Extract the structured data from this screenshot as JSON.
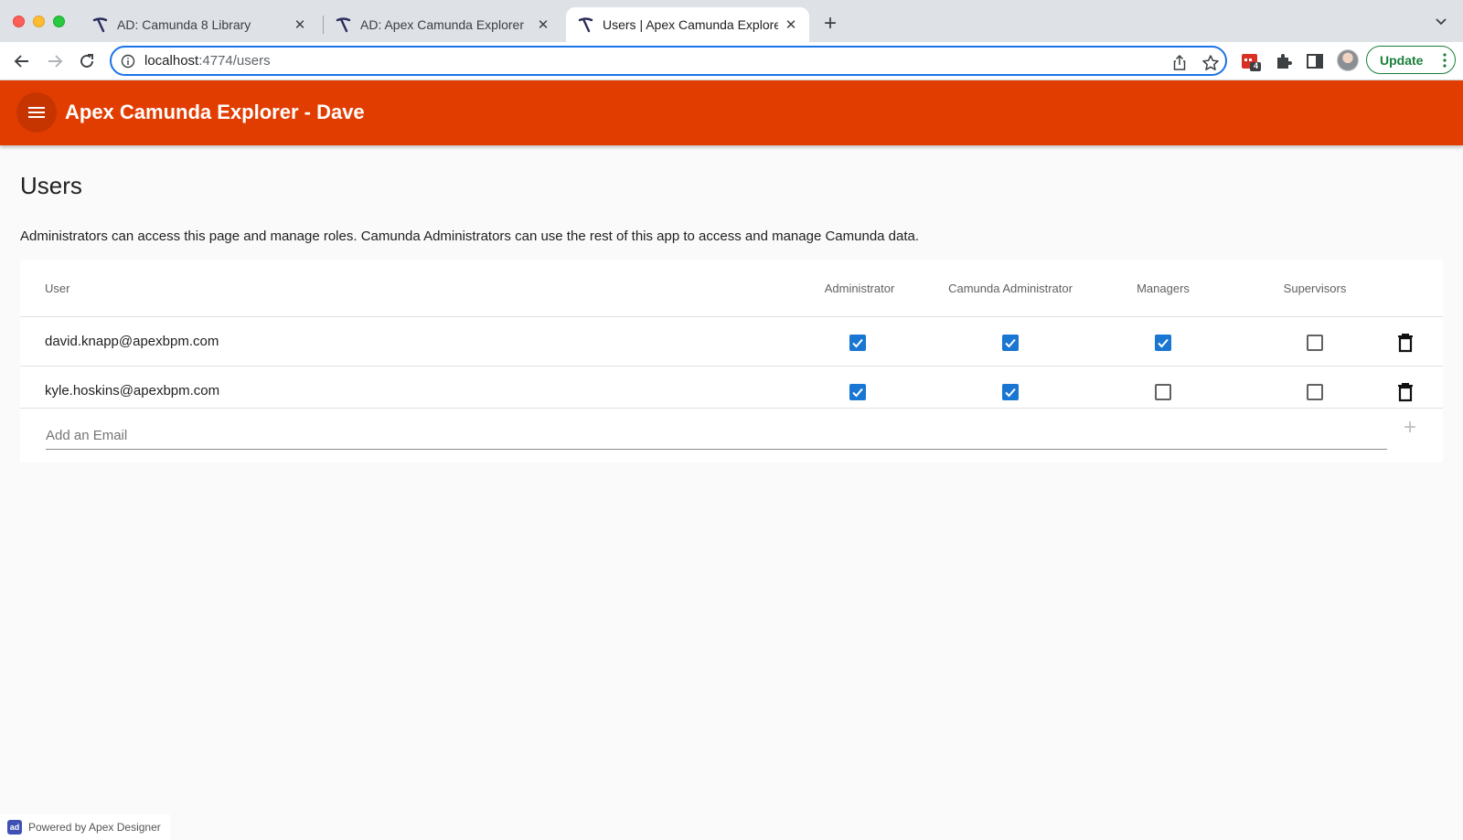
{
  "browser": {
    "tabs": [
      {
        "title": "AD: Camunda 8 Library",
        "active": false
      },
      {
        "title": "AD: Apex Camunda Explorer",
        "active": false
      },
      {
        "title": "Users | Apex Camunda Explorer",
        "active": true
      }
    ],
    "url_host": "localhost",
    "url_path": ":4774/users",
    "extension_badge": "4",
    "update_label": "Update"
  },
  "app": {
    "title": "Apex Camunda Explorer - Dave"
  },
  "page": {
    "title": "Users",
    "description": "Administrators can access this page and manage roles. Camunda Administrators can use the rest of this app to access and manage Camunda data.",
    "columns": [
      "User",
      "Administrator",
      "Camunda Administrator",
      "Managers",
      "Supervisors"
    ],
    "users": [
      {
        "email": "david.knapp@apexbpm.com",
        "roles": [
          true,
          true,
          true,
          false
        ]
      },
      {
        "email": "kyle.hoskins@apexbpm.com",
        "roles": [
          true,
          true,
          false,
          false
        ]
      }
    ],
    "add_placeholder": "Add an Email"
  },
  "footer": {
    "logo_text": "ad",
    "powered_by": "Powered by Apex Designer"
  },
  "colors": {
    "header": "#e23d01",
    "checkbox": "#1976d2",
    "update": "#188038"
  }
}
